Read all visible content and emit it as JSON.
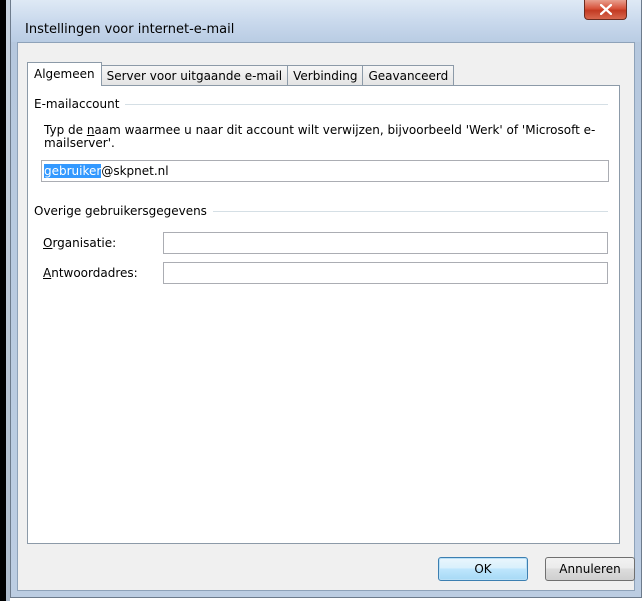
{
  "window": {
    "title": "Instellingen voor internet-e-mail"
  },
  "tabs": [
    {
      "label": "Algemeen",
      "active": true
    },
    {
      "label": "Server voor uitgaande e-mail",
      "active": false
    },
    {
      "label": "Verbinding",
      "active": false
    },
    {
      "label": "Geavanceerd",
      "active": false
    }
  ],
  "account": {
    "heading": "E-mailaccount",
    "description_pre": "Typ de ",
    "description_mnemonic": "n",
    "description_post": "aam waarmee u naar dit account wilt verwijzen, bijvoorbeeld 'Werk' of 'Microsoft e-mailserver'.",
    "name_selected": "gebruiker",
    "name_rest": "@skpnet.nl"
  },
  "other": {
    "heading": "Overige gebruikersgegevens",
    "org_mnemonic": "O",
    "org_rest": "rganisatie:",
    "org_value": "",
    "reply_mnemonic": "A",
    "reply_rest": "ntwoordadres:",
    "reply_value": ""
  },
  "buttons": {
    "ok": "OK",
    "cancel": "Annuleren"
  },
  "colors": {
    "selection": "#3399ff",
    "close": "#c23a22"
  }
}
